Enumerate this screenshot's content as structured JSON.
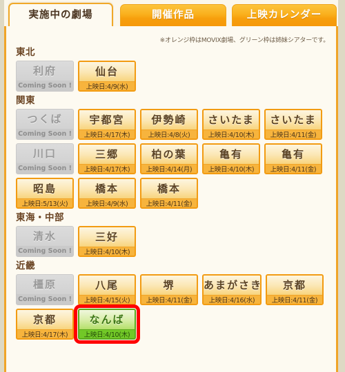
{
  "tabs": [
    {
      "label": "実施中の劇場",
      "active": true
    },
    {
      "label": "開催作品",
      "active": false
    },
    {
      "label": "上映カレンダー",
      "active": false
    }
  ],
  "note": "※オレンジ枠はMOVIX劇場、グリーン枠は姉妹シアターです。",
  "legend": {
    "orange_meaning": "MOVIX劇場",
    "green_meaning": "姉妹シアター",
    "orange_color": "#f29b12",
    "green_color": "#5aa81b",
    "highlight_color": "#ff0000"
  },
  "coming_soon_label": "Coming Soon !",
  "regions": [
    {
      "title": "東北",
      "rows": [
        [
          {
            "name": "利府",
            "date": "Coming Soon !",
            "type": "soon"
          },
          {
            "name": "仙台",
            "date": "上映日:4/9(水)",
            "type": "orange"
          }
        ]
      ]
    },
    {
      "title": "関東",
      "rows": [
        [
          {
            "name": "つくば",
            "date": "Coming Soon !",
            "type": "soon"
          },
          {
            "name": "宇都宮",
            "date": "上映日:4/17(木)",
            "type": "orange"
          },
          {
            "name": "伊勢崎",
            "date": "上映日:4/8(火)",
            "type": "orange"
          },
          {
            "name": "さいたま",
            "date": "上映日:4/10(木)",
            "type": "orange"
          },
          {
            "name": "さいたま",
            "date": "上映日:4/11(金)",
            "type": "orange"
          }
        ],
        [
          {
            "name": "川口",
            "date": "Coming Soon !",
            "type": "soon"
          },
          {
            "name": "三郷",
            "date": "上映日:4/17(木)",
            "type": "orange"
          },
          {
            "name": "柏の葉",
            "date": "上映日:4/14(月)",
            "type": "orange"
          },
          {
            "name": "亀有",
            "date": "上映日:4/10(木)",
            "type": "orange"
          },
          {
            "name": "亀有",
            "date": "上映日:4/11(金)",
            "type": "orange"
          }
        ],
        [
          {
            "name": "昭島",
            "date": "上映日:5/13(火)",
            "type": "orange"
          },
          {
            "name": "橋本",
            "date": "上映日:4/9(水)",
            "type": "orange"
          },
          {
            "name": "橋本",
            "date": "上映日:4/11(金)",
            "type": "orange"
          }
        ]
      ]
    },
    {
      "title": "東海・中部",
      "rows": [
        [
          {
            "name": "清水",
            "date": "Coming Soon !",
            "type": "soon"
          },
          {
            "name": "三好",
            "date": "上映日:4/10(木)",
            "type": "orange"
          }
        ]
      ]
    },
    {
      "title": "近畿",
      "rows": [
        [
          {
            "name": "橿原",
            "date": "Coming Soon !",
            "type": "soon"
          },
          {
            "name": "八尾",
            "date": "上映日:4/15(火)",
            "type": "orange"
          },
          {
            "name": "堺",
            "date": "上映日:4/11(金)",
            "type": "orange"
          },
          {
            "name": "あまがさき",
            "date": "上映日:4/16(水)",
            "type": "orange"
          },
          {
            "name": "京都",
            "date": "上映日:4/11(金)",
            "type": "orange"
          }
        ],
        [
          {
            "name": "京都",
            "date": "上映日:4/17(木)",
            "type": "orange"
          },
          {
            "name": "なんば",
            "date": "上映日:4/10(木)",
            "type": "green",
            "highlight": true
          }
        ]
      ]
    }
  ]
}
